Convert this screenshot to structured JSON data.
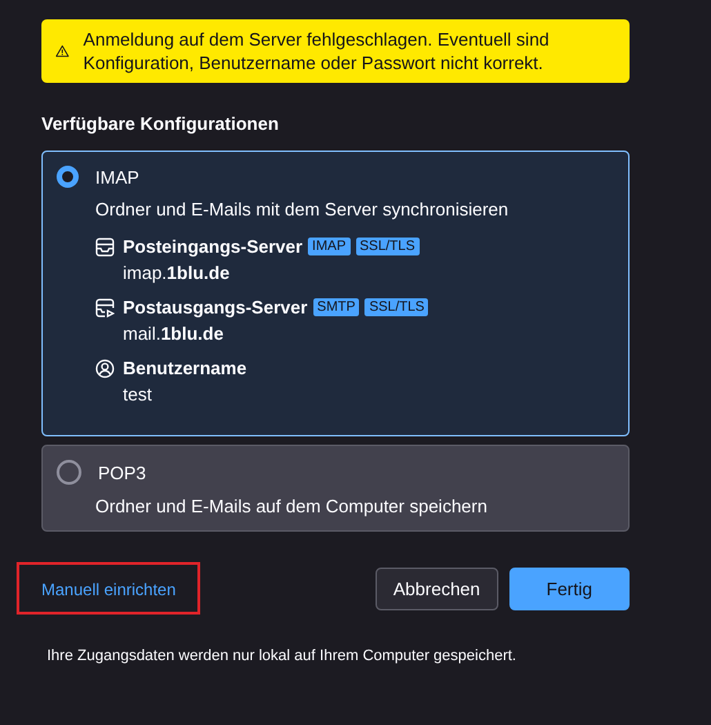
{
  "alert": {
    "kind": "warning",
    "text": "Anmeldung auf dem Server fehlgeschlagen. Eventuell sind Konfiguration, Benutzername oder Passwort nicht korrekt."
  },
  "heading": "Verfügbare Konfigurationen",
  "configurations": [
    {
      "name": "IMAP",
      "selected": true,
      "description": "Ordner und E-Mails mit dem Server synchronisieren",
      "details": [
        {
          "kind": "incoming",
          "label": "Posteingangs-Server",
          "tags": [
            "IMAP",
            "SSL/TLS"
          ],
          "value": "imap.**1blu.de**"
        },
        {
          "kind": "outgoing",
          "label": "Postausgangs-Server",
          "tags": [
            "SMTP",
            "SSL/TLS"
          ],
          "value": "mail.**1blu.de**"
        },
        {
          "kind": "user",
          "label": "Benutzername",
          "value": "test"
        }
      ]
    },
    {
      "name": "POP3",
      "selected": false,
      "description": "Ordner und E-Mails auf dem Computer speichern"
    }
  ],
  "manual_link": {
    "label": "Manuell einrichten",
    "highlighted": true
  },
  "buttons": [
    {
      "label": "Abbrechen",
      "kind": "secondary"
    },
    {
      "label": "Fertig",
      "kind": "primary"
    }
  ],
  "footer": "Ihre Zugangsdaten werden nur lokal auf Ihrem Computer gespeichert."
}
